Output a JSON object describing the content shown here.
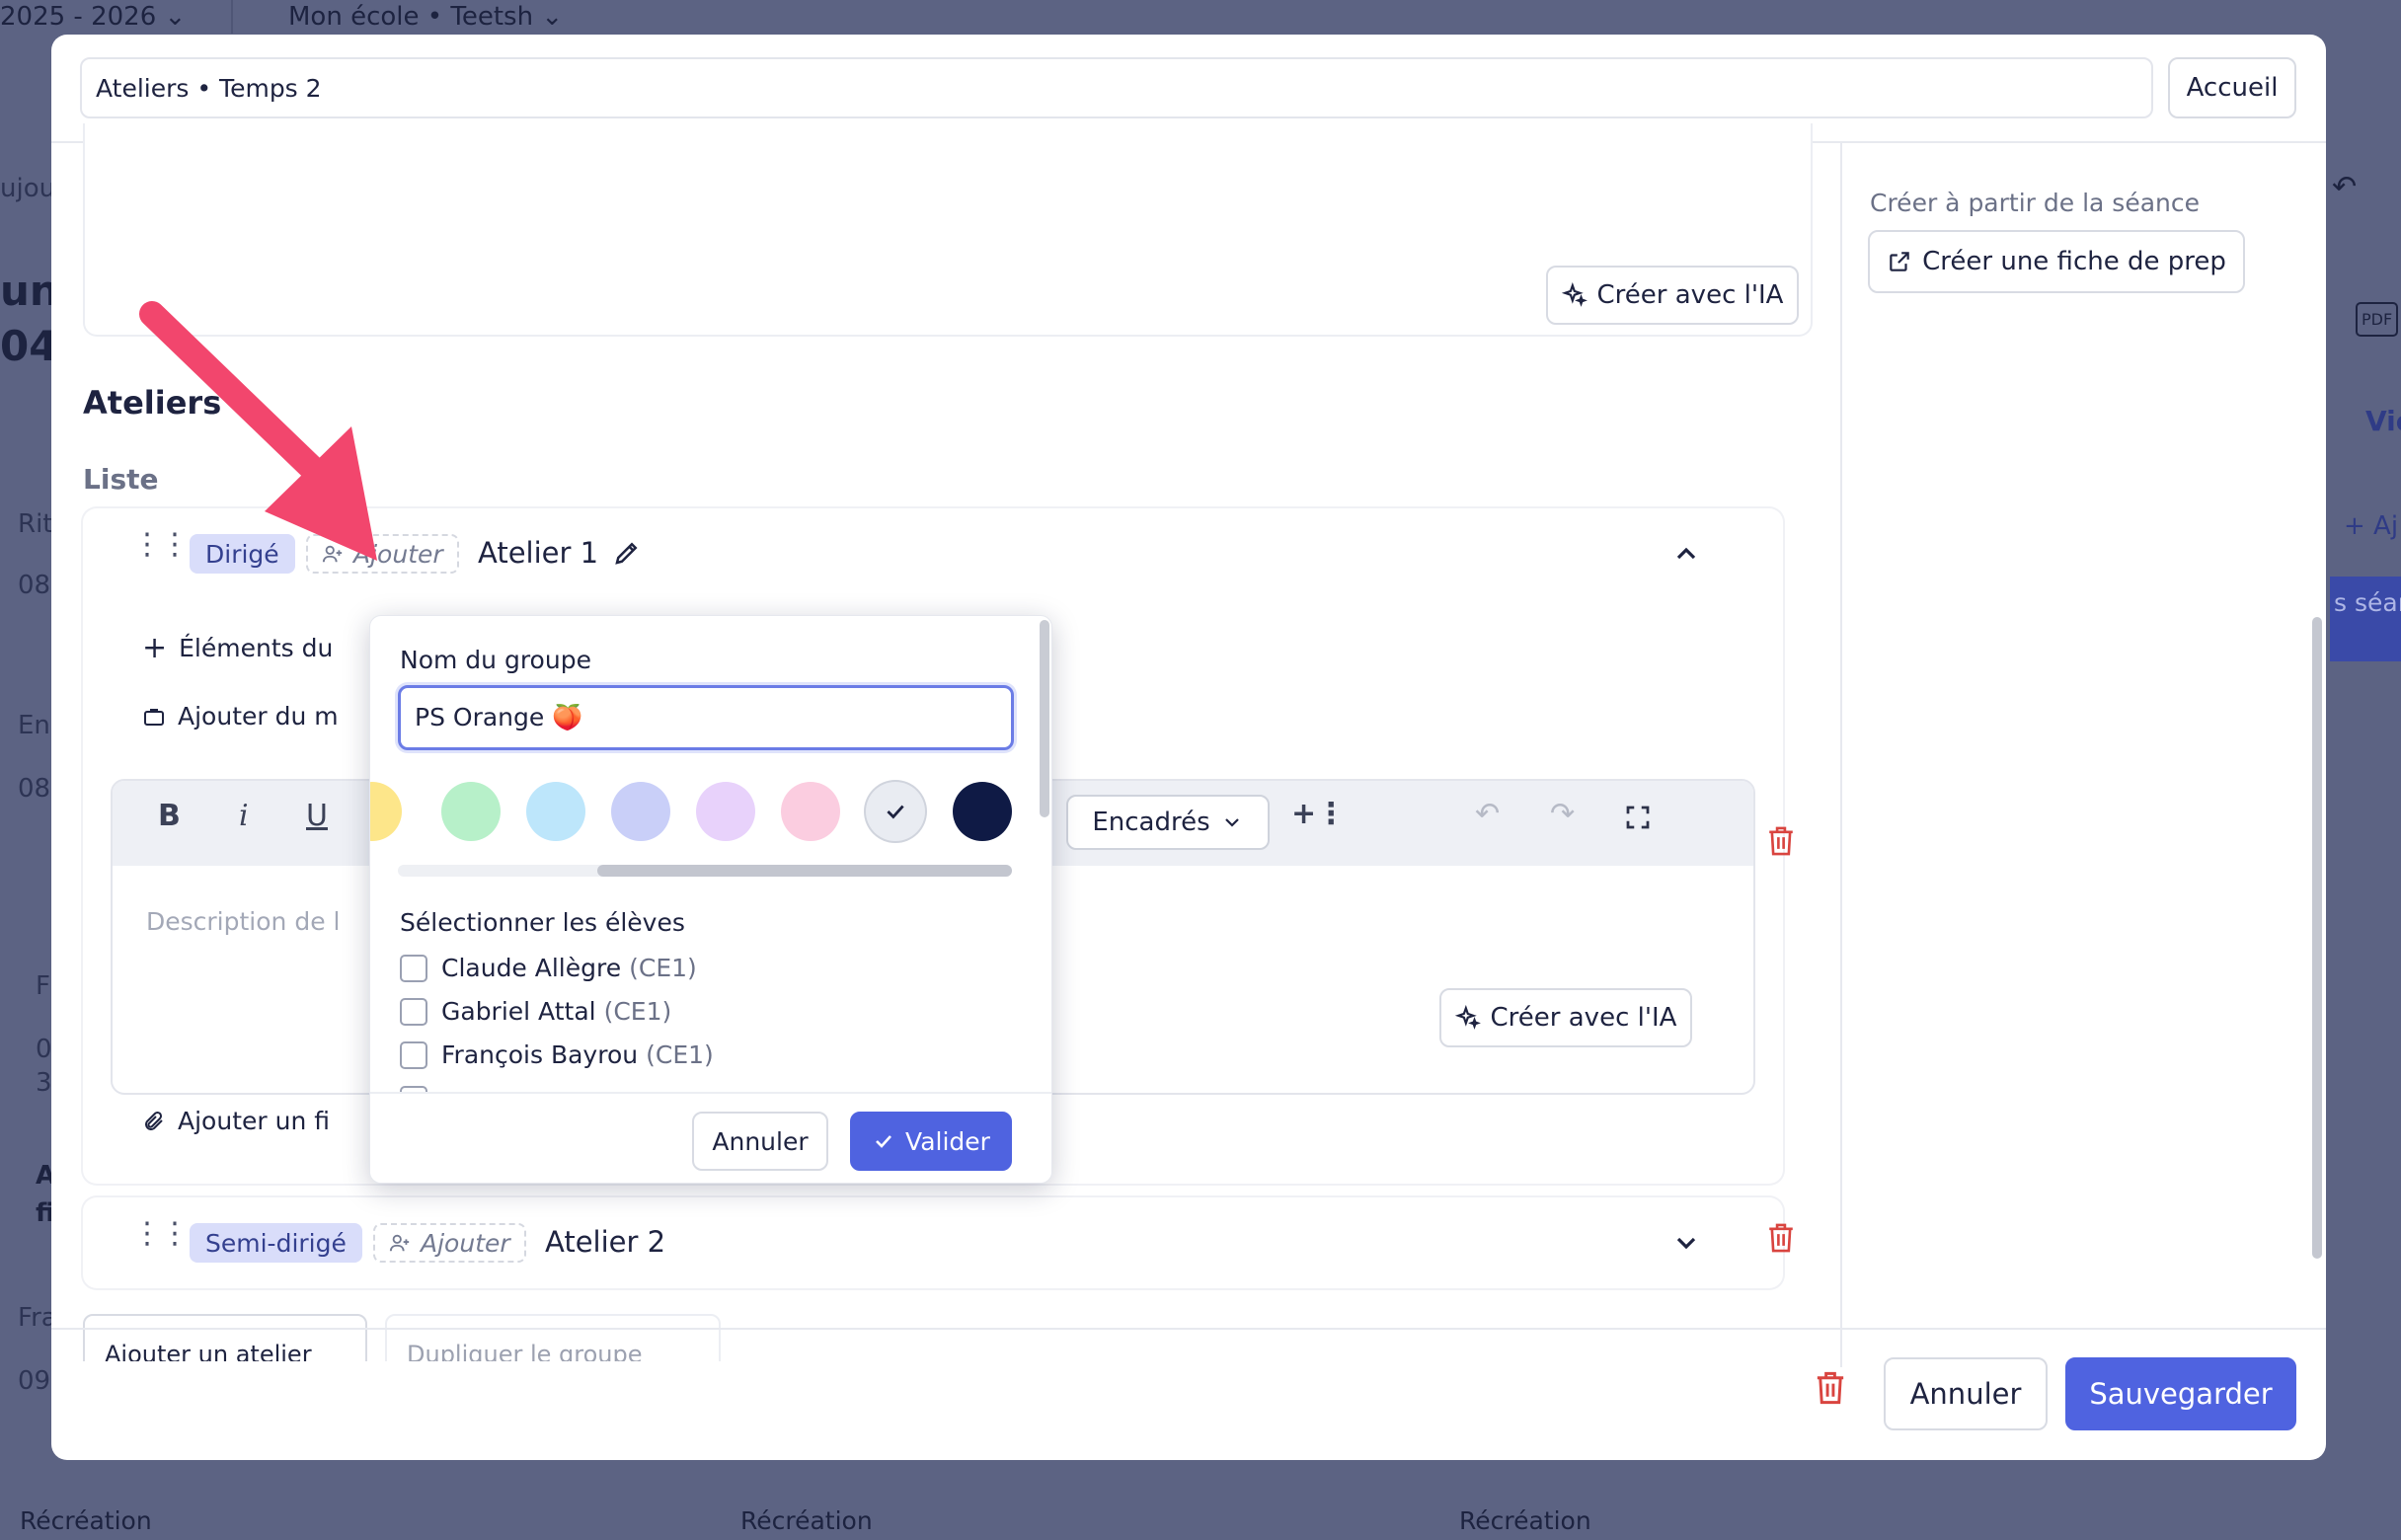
{
  "background": {
    "year_select": "2025 - 2026",
    "school_select": "Mon école • Teetsh",
    "recess_labels": [
      "Récréation",
      "Récréation",
      "Récréation"
    ],
    "view_button": "Vie",
    "add_label": "+ Aj",
    "sessions_label": "s séan",
    "pdf_label": "PDF",
    "left_snippets": [
      "ujou",
      "un",
      "04",
      "Rit",
      "08",
      "En",
      "08",
      "F",
      "0",
      "3",
      "A",
      "fi",
      "Fra",
      "09"
    ]
  },
  "modal": {
    "header_path": "Ateliers • Temps 2",
    "home_button": "Accueil",
    "create_ai_label": "Créer avec l'IA",
    "side": {
      "create_from_label": "Créer à partir de la séance",
      "create_sheet_button": "Créer une fiche de prep"
    },
    "section_title": "Ateliers",
    "list_title": "Liste",
    "workshops": [
      {
        "badge": "Dirigé",
        "add_group": "Ajouter",
        "name": "Atelier 1"
      },
      {
        "badge": "Semi-dirigé",
        "add_group": "Ajouter",
        "name": "Atelier 2"
      }
    ],
    "elements_label": "Éléments du",
    "add_material_label": "Ajouter du m",
    "add_file_label": "Ajouter un fi",
    "editor": {
      "bold": "B",
      "italic": "i",
      "underline": "U",
      "boxes_select": "Encadrés",
      "placeholder": "Description de l"
    },
    "bottom_buttons_partial": [
      "Ajouter un atelier",
      "Dupliquer le groupe"
    ],
    "footer": {
      "cancel_button": "Annuler",
      "save_button": "Sauvegarder"
    }
  },
  "popover": {
    "group_name_label": "Nom du groupe",
    "group_name_value": "PS Orange 🍑",
    "colors": [
      "#fde68a",
      "#b7f0c9",
      "#bde6fb",
      "#c9cff8",
      "#e8d2fb",
      "#fbcde0",
      "#e9ecf2",
      "#0f1a45"
    ],
    "selected_color_index": 6,
    "select_students_label": "Sélectionner les élèves",
    "students": [
      {
        "name": "Claude Allègre",
        "level": "(CE1)"
      },
      {
        "name": "Gabriel Attal",
        "level": "(CE1)"
      },
      {
        "name": "François Bayrou",
        "level": "(CE1)"
      }
    ],
    "cancel_button": "Annuler",
    "validate_button": "Valider"
  },
  "colors": {
    "accent": "#4f63e0",
    "badge_bg": "#d9ddfa",
    "arrow": "#f2466d",
    "danger": "#d9443f"
  }
}
